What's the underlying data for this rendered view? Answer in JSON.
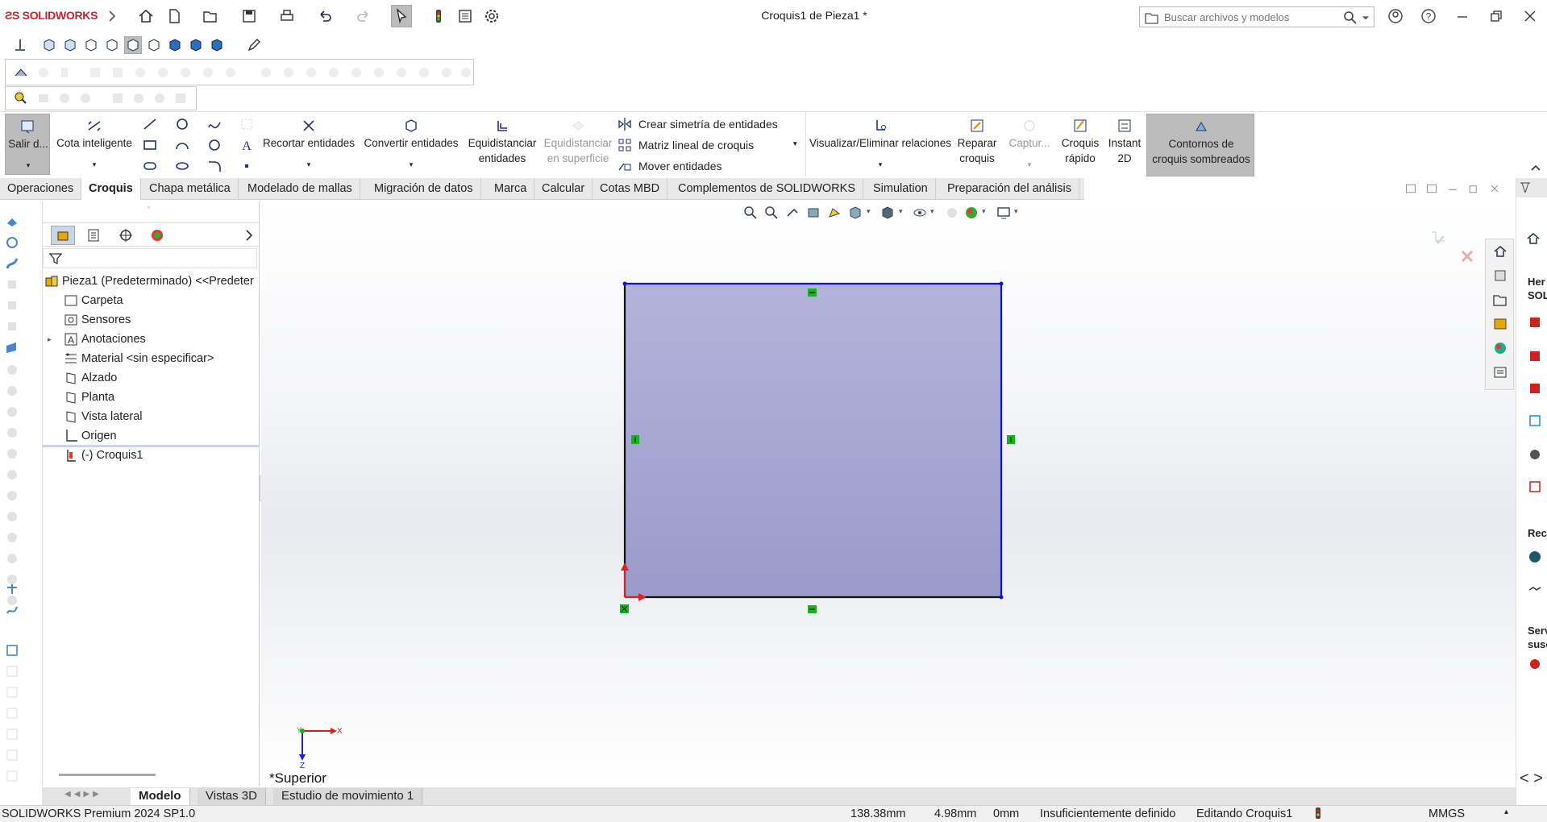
{
  "app": {
    "logo": "SOLIDWORKS",
    "window_title": "Croquis1 de Pieza1 *"
  },
  "search": {
    "placeholder": "Buscar archivos y modelos"
  },
  "icons": [
    "home-icon",
    "new-document-icon",
    "open-icon",
    "save-icon",
    "print-icon",
    "undo-icon",
    "redo-icon",
    "select-icon",
    "traffic-light-icon",
    "file-properties-icon",
    "options-gear-icon",
    "help-icon",
    "account-icon"
  ],
  "commands": {
    "exit_sketch": "Salir d...",
    "smart_dimension": "Cota inteligente",
    "trim": "Recortar entidades",
    "convert": "Convertir entidades",
    "offset_line1": "Equidistanciar",
    "offset_line2": "entidades",
    "offset_surface_line1": "Equidistanciar",
    "offset_surface_line2": "en superficie",
    "mirror": "Crear simetría de entidades",
    "linear_pattern": "Matriz lineal de croquis",
    "move": "Mover entidades",
    "relations": "Visualizar/Eliminar relaciones",
    "repair_line1": "Reparar",
    "repair_line2": "croquis",
    "capture": "Captur...",
    "rapid_line1": "Croquis",
    "rapid_line2": "rápido",
    "instant2d_line1": "Instant",
    "instant2d_line2": "2D",
    "shaded_line1": "Contornos de",
    "shaded_line2": "croquis sombreados"
  },
  "tabs": [
    "Operaciones",
    "Croquis",
    "Chapa metálica",
    "Modelado de mallas",
    "Migración de datos",
    "Marca",
    "Calcular",
    "Cotas MBD",
    "Complementos de SOLIDWORKS",
    "Simulation",
    "Preparación del análisis"
  ],
  "active_tab": "Croquis",
  "tree": {
    "root": "Pieza1 (Predeterminado) <<Predeter",
    "items": [
      "Carpeta",
      "Sensores",
      "Anotaciones",
      "Material <sin especificar>",
      "Alzado",
      "Planta",
      "Vista lateral",
      "Origen",
      "(-) Croquis1"
    ]
  },
  "viewport": {
    "view_label": "*Superior",
    "axis_x": "X",
    "axis_y": "Y",
    "axis_z": "Z"
  },
  "right_pane": {
    "title_line1": "Her",
    "title_line2": "SOLI",
    "section2": "Recu",
    "section3_line1": "Serv",
    "section3_line2": "susc"
  },
  "bottom_tabs": [
    "Modelo",
    "Vistas 3D",
    "Estudio de movimiento 1"
  ],
  "active_bottom_tab": "Modelo",
  "status": {
    "product": "SOLIDWORKS Premium 2024 SP1.0",
    "x": "138.38mm",
    "y": "4.98mm",
    "z": "0mm",
    "state": "Insuficientemente definido",
    "editing": "Editando Croquis1",
    "units": "MMGS"
  },
  "colors": {
    "sketch_fill": "#a9a9d4",
    "sketch_line": "#1111dd",
    "brand_red": "#d0202a",
    "relation_green": "#17b31f"
  }
}
